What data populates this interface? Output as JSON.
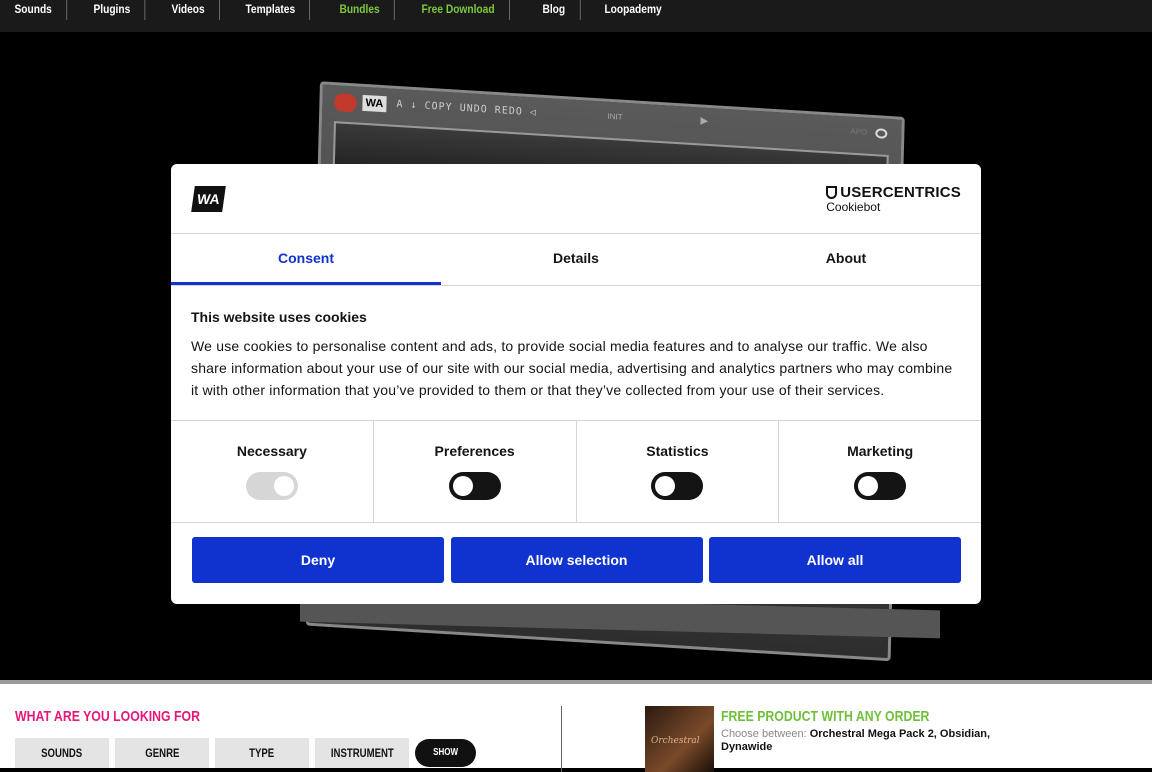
{
  "nav": {
    "items": [
      {
        "label": "Sounds"
      },
      {
        "label": "Plugins"
      },
      {
        "label": "Videos"
      },
      {
        "label": "Templates"
      },
      {
        "label": "Bundles"
      },
      {
        "label": "Free Download"
      },
      {
        "label": "Blog"
      },
      {
        "label": "Loopademy"
      }
    ],
    "highlight_color": "#7ec83e"
  },
  "hero": {
    "plugin_logo": "WA",
    "plugin_lcd": "A  ↓  COPY UNDO REDO ◁",
    "plugin_init": "INIT",
    "plugin_apo": "APO"
  },
  "cookie_modal": {
    "brand_logo": "WA",
    "provider_logo": "USERCENTRICS",
    "provider_sub": "Cookiebot",
    "tabs": [
      {
        "label": "Consent",
        "active": true
      },
      {
        "label": "Details",
        "active": false
      },
      {
        "label": "About",
        "active": false
      }
    ],
    "heading": "This website uses cookies",
    "body": "We use cookies to personalise content and ads, to provide social media features and to analyse our traffic. We also share information about your use of our site with our social media, advertising and analytics partners who may combine it with other information that you’ve provided to them or that they’ve collected from your use of their services.",
    "categories": [
      {
        "label": "Necessary",
        "enabled": true,
        "disabled": true
      },
      {
        "label": "Preferences",
        "enabled": false,
        "disabled": false
      },
      {
        "label": "Statistics",
        "enabled": false,
        "disabled": false
      },
      {
        "label": "Marketing",
        "enabled": false,
        "disabled": false
      }
    ],
    "buttons": {
      "deny": "Deny",
      "allow_selection": "Allow selection",
      "allow_all": "Allow all"
    },
    "accent_color": "#1032cf"
  },
  "search": {
    "heading": "WHAT ARE YOU LOOKING FOR",
    "heading_color": "#e6177a",
    "filters": [
      "SOUNDS",
      "GENRE",
      "TYPE",
      "INSTRUMENT"
    ],
    "show_button": "SHOW"
  },
  "promo": {
    "title": "FREE PRODUCT WITH ANY ORDER",
    "title_color": "#6fbf3b",
    "choose_label": "Choose between:",
    "products": "Orchestral Mega Pack 2, Obsidian, Dynawide",
    "image_script": "Orchestral"
  }
}
